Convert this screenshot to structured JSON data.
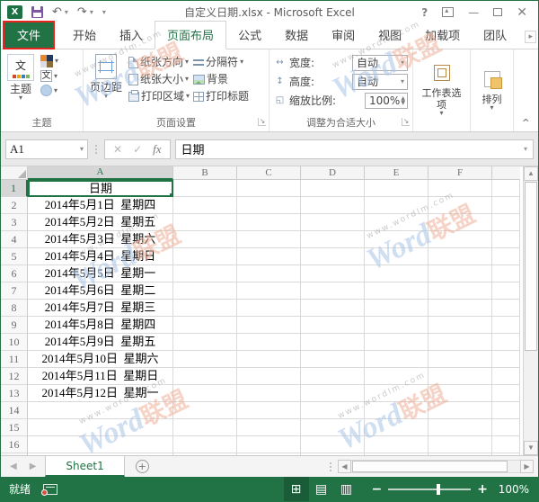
{
  "titlebar": {
    "title": "自定义日期.xlsx - Microsoft Excel"
  },
  "tabs": [
    {
      "id": "file",
      "label": "文件",
      "type": "file"
    },
    {
      "id": "home",
      "label": "开始"
    },
    {
      "id": "insert",
      "label": "插入"
    },
    {
      "id": "page-layout",
      "label": "页面布局",
      "active": true
    },
    {
      "id": "formulas",
      "label": "公式"
    },
    {
      "id": "data",
      "label": "数据"
    },
    {
      "id": "review",
      "label": "审阅"
    },
    {
      "id": "view",
      "label": "视图"
    },
    {
      "id": "add-ins",
      "label": "加载项"
    },
    {
      "id": "team",
      "label": "团队"
    }
  ],
  "ribbon": {
    "themes": {
      "group_label": "主题",
      "big_label": "主题"
    },
    "page_setup": {
      "group_label": "页面设置",
      "margins": "页边距",
      "orientation": "纸张方向",
      "paper_size": "纸张大小",
      "print_area": "打印区域",
      "breaks": "分隔符",
      "background": "背景",
      "print_titles": "打印标题"
    },
    "scale_to_fit": {
      "group_label": "调整为合适大小",
      "width_label": "宽度:",
      "width_value": "自动",
      "height_label": "高度:",
      "height_value": "自动",
      "scale_label": "缩放比例:",
      "scale_value": "100%"
    },
    "sheet_options_label": "工作表选项",
    "arrange_label": "排列"
  },
  "formula_bar": {
    "name_box": "A1",
    "value": "日期"
  },
  "grid": {
    "columns": [
      "A",
      "B",
      "C",
      "D",
      "E",
      "F"
    ],
    "row_count": 17,
    "selected_cell": "A1",
    "a1": "日期",
    "dates": [
      "2014年5月1日  星期四",
      "2014年5月2日  星期五",
      "2014年5月3日  星期六",
      "2014年5月4日  星期日",
      "2014年5月5日  星期一",
      "2014年5月6日  星期二",
      "2014年5月7日  星期三",
      "2014年5月8日  星期四",
      "2014年5月9日  星期五",
      "2014年5月10日  星期六",
      "2014年5月11日  星期日",
      "2014年5月12日  星期一"
    ]
  },
  "sheet_bar": {
    "active_tab": "Sheet1"
  },
  "status_bar": {
    "ready": "就绪",
    "zoom_level": "100%"
  },
  "watermark": {
    "url": "www.wordlm.com",
    "brand_latin": "Word",
    "brand_cjk": "联盟"
  },
  "colors": {
    "excel_green": "#217346",
    "annotation_red": "#e5241d",
    "selection_green": "#217346",
    "watermark_blue": "#a9c4e6",
    "watermark_red": "#f0b09a"
  }
}
